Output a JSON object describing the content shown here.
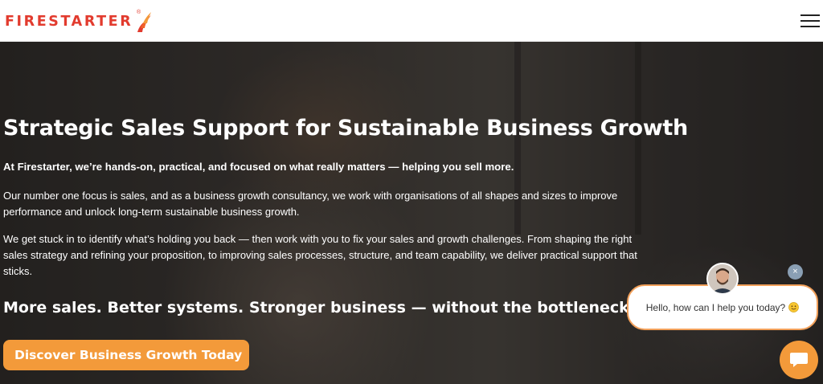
{
  "brand": {
    "name": "FIRESTARTER",
    "registered_mark": "®",
    "accent_color": "#e23b2e"
  },
  "header": {
    "menu_icon": "hamburger-menu-icon"
  },
  "hero": {
    "title": "Strategic Sales Support for Sustainable Business Growth",
    "lead": "At Firestarter, we’re hands-on, practical, and focused on what really matters — helping you sell more.",
    "paragraph_1": "Our number one focus is sales, and as a business growth consultancy, we work with organisations of all shapes and sizes to improve performance and unlock long-term sustainable business growth.",
    "paragraph_2": "We get stuck in to identify what’s holding you back — then work with you to fix your sales and growth challenges. From shaping the right sales strategy and refining your proposition, to improving sales processes, structure, and team capability, we deliver practical support that sticks.",
    "tagline": "More sales. Better systems. Stronger business — without the bottlenecks.",
    "cta_label": "Discover Business Growth Today",
    "cta_color": "#f39a3a"
  },
  "chat": {
    "greeting": "Hello, how can I help you today?",
    "close_label": "×",
    "launcher_icon": "chat-bubble-icon",
    "border_color": "#f2a05a"
  }
}
